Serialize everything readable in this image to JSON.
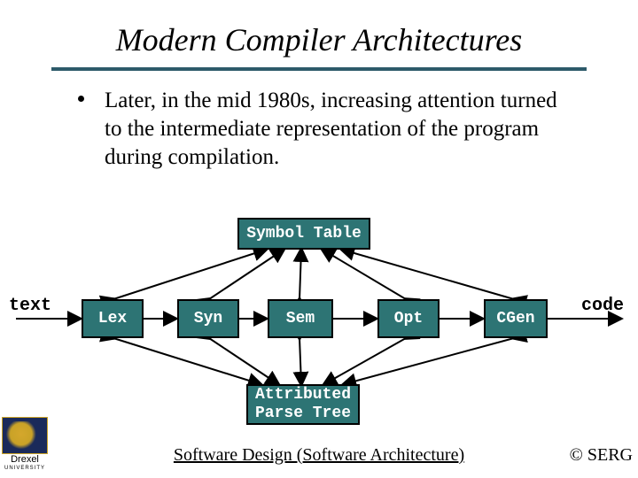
{
  "title": "Modern Compiler Architectures",
  "bullet": "Later, in the mid 1980s, increasing attention turned to the intermediate representation of the program during compilation.",
  "diagram": {
    "symbol_table": "Symbol Table",
    "input_label": "text",
    "output_label": "code",
    "stages": {
      "lex": "Lex",
      "syn": "Syn",
      "sem": "Sem",
      "opt": "Opt",
      "cgen": "CGen"
    },
    "parse_tree": "Attributed\nParse Tree"
  },
  "footer": "Software Design (Software Architecture)",
  "copyright": "© SERG",
  "logo": {
    "name": "Drexel",
    "sub": "UNIVERSITY"
  }
}
